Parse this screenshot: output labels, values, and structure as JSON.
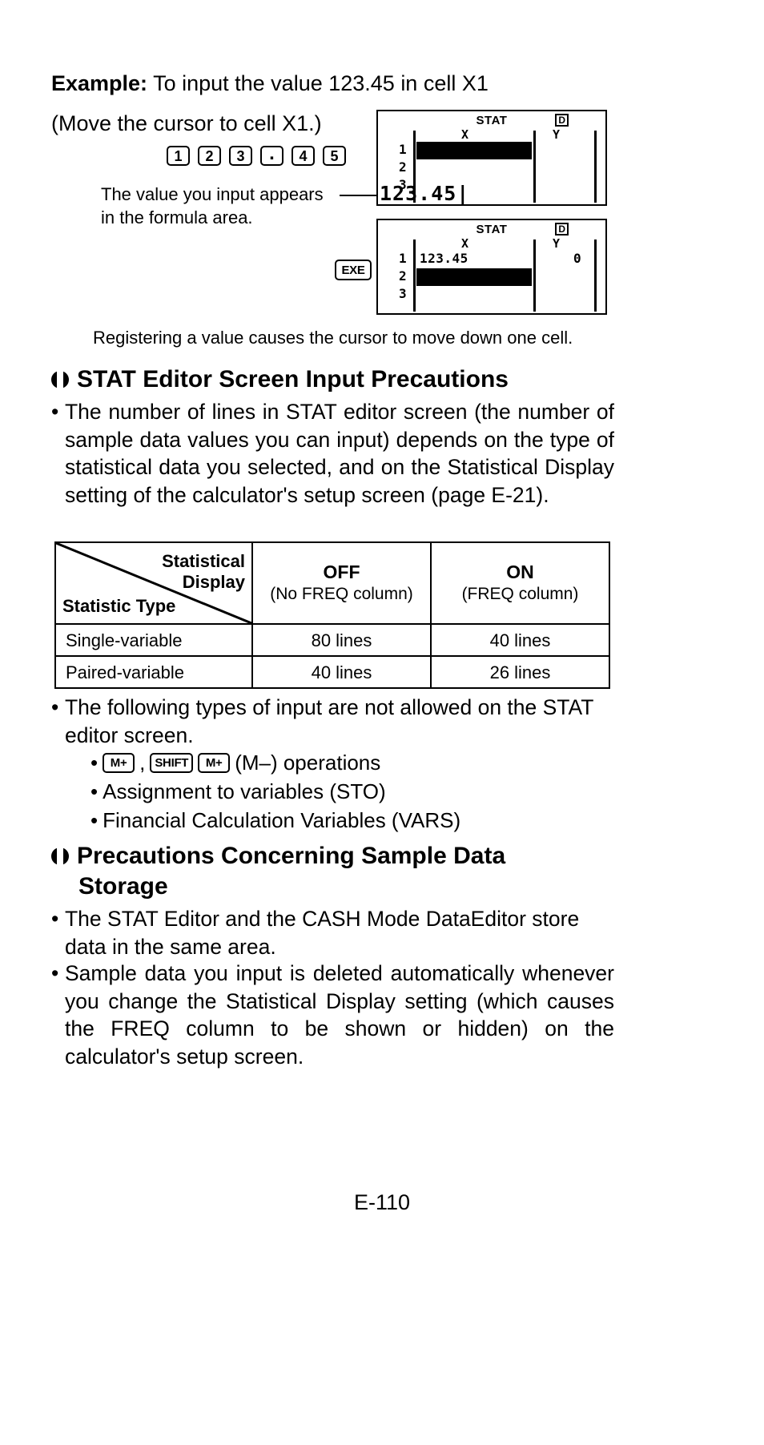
{
  "example": {
    "lead": "Example:",
    "text": "To input the value 123.45 in cell X1",
    "move_instruction": "(Move the cursor to cell X1.)",
    "keys": [
      "1",
      "2",
      "3",
      ".",
      "4",
      "5"
    ],
    "exe_key": "EXE",
    "caption_line1": "The value you input appears",
    "caption_line2": "in the formula area.",
    "register_note": "Registering a value causes the cursor to move down one cell."
  },
  "lcd1": {
    "status_stat": "STAT",
    "status_d": "D",
    "header_x": "X",
    "header_y": "Y",
    "rows": [
      "1",
      "2",
      "3"
    ],
    "formula": "123.45|"
  },
  "lcd2": {
    "status_stat": "STAT",
    "status_d": "D",
    "header_x": "X",
    "header_y": "Y",
    "rows": [
      "1",
      "2",
      "3"
    ],
    "x1_value": "123.45",
    "y1_value": "0"
  },
  "section1": {
    "heading": "STAT Editor Screen Input Precautions",
    "para1": "The number of lines in STAT editor screen (the number of sample data values you can input) depends on the type of statistical data you selected, and on the Statistical Display setting of the calculator's setup screen (page E-21).",
    "para2": "The following types of input are not allowed on the STAT editor screen.",
    "sub_items": [
      {
        "keys": [
          "M+"
        ],
        "keys2": [
          "SHIFT",
          "M+"
        ],
        "text": "(M–) operations"
      },
      {
        "text": "Assignment to variables (STO)"
      },
      {
        "text": "Financial Calculation Variables (VARS)"
      }
    ]
  },
  "table": {
    "corner_top_label_line1": "Statistical",
    "corner_top_label_line2": "Display",
    "corner_bottom_label": "Statistic Type",
    "columns": [
      {
        "main": "OFF",
        "sub": "(No FREQ column)"
      },
      {
        "main": "ON",
        "sub": "(FREQ column)"
      }
    ],
    "rows": [
      {
        "label": "Single-variable",
        "values": [
          "80 lines",
          "40 lines"
        ]
      },
      {
        "label": "Paired-variable",
        "values": [
          "40 lines",
          "26 lines"
        ]
      }
    ]
  },
  "section2": {
    "heading_line1": "Precautions Concerning Sample Data",
    "heading_line2": "Storage",
    "para1": "The STAT Editor and the CASH Mode DataEditor store data in the same area.",
    "para2": "Sample data you input is deleted automatically whenever you change the Statistical Display setting (which causes the FREQ column to be shown or hidden) on the calculator's setup screen."
  },
  "footer": {
    "page_number": "E-110"
  }
}
